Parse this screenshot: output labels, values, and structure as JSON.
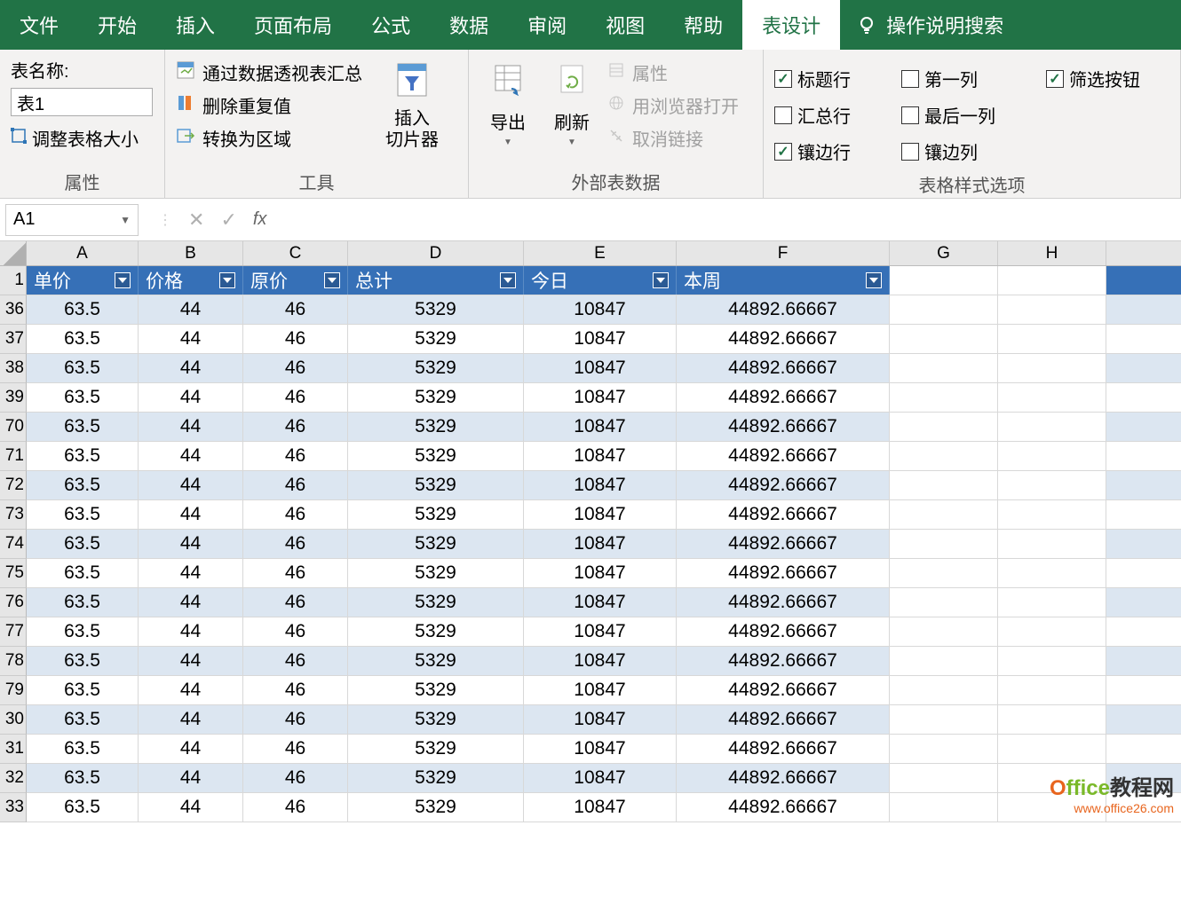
{
  "tabs": [
    "文件",
    "开始",
    "插入",
    "页面布局",
    "公式",
    "数据",
    "审阅",
    "视图",
    "帮助",
    "表设计"
  ],
  "activeTab": "表设计",
  "searchHelp": "操作说明搜索",
  "ribbon": {
    "properties": {
      "tableNameLabel": "表名称:",
      "tableNameValue": "表1",
      "resize": "调整表格大小",
      "groupLabel": "属性"
    },
    "tools": {
      "pivot": "通过数据透视表汇总",
      "dedup": "删除重复值",
      "convert": "转换为区域",
      "slicer": "插入\n切片器",
      "groupLabel": "工具"
    },
    "external": {
      "export": "导出",
      "refresh": "刷新",
      "props": "属性",
      "browser": "用浏览器打开",
      "unlink": "取消链接",
      "groupLabel": "外部表数据"
    },
    "styleOptions": {
      "headerRow": "标题行",
      "totalRow": "汇总行",
      "bandedRows": "镶边行",
      "firstCol": "第一列",
      "lastCol": "最后一列",
      "bandedCols": "镶边列",
      "filterBtn": "筛选按钮",
      "groupLabel": "表格样式选项"
    }
  },
  "formulaBar": {
    "nameBox": "A1",
    "fx": "fx"
  },
  "columns": [
    "A",
    "B",
    "C",
    "D",
    "E",
    "F",
    "G",
    "H"
  ],
  "tableHeaders": [
    "单价",
    "价格",
    "原价",
    "总计",
    "今日",
    "本周"
  ],
  "rowNumbers": [
    "1",
    "36",
    "37",
    "38",
    "39",
    "70",
    "71",
    "72",
    "73",
    "74",
    "75",
    "76",
    "77",
    "78",
    "79",
    "30",
    "31",
    "32",
    "33"
  ],
  "dataRow": [
    "63.5",
    "44",
    "46",
    "5329",
    "10847",
    "44892.66667"
  ],
  "watermark": {
    "brand1": "O",
    "brand2": "ffice",
    "brand3": "教程网",
    "url": "www.office26.com"
  }
}
